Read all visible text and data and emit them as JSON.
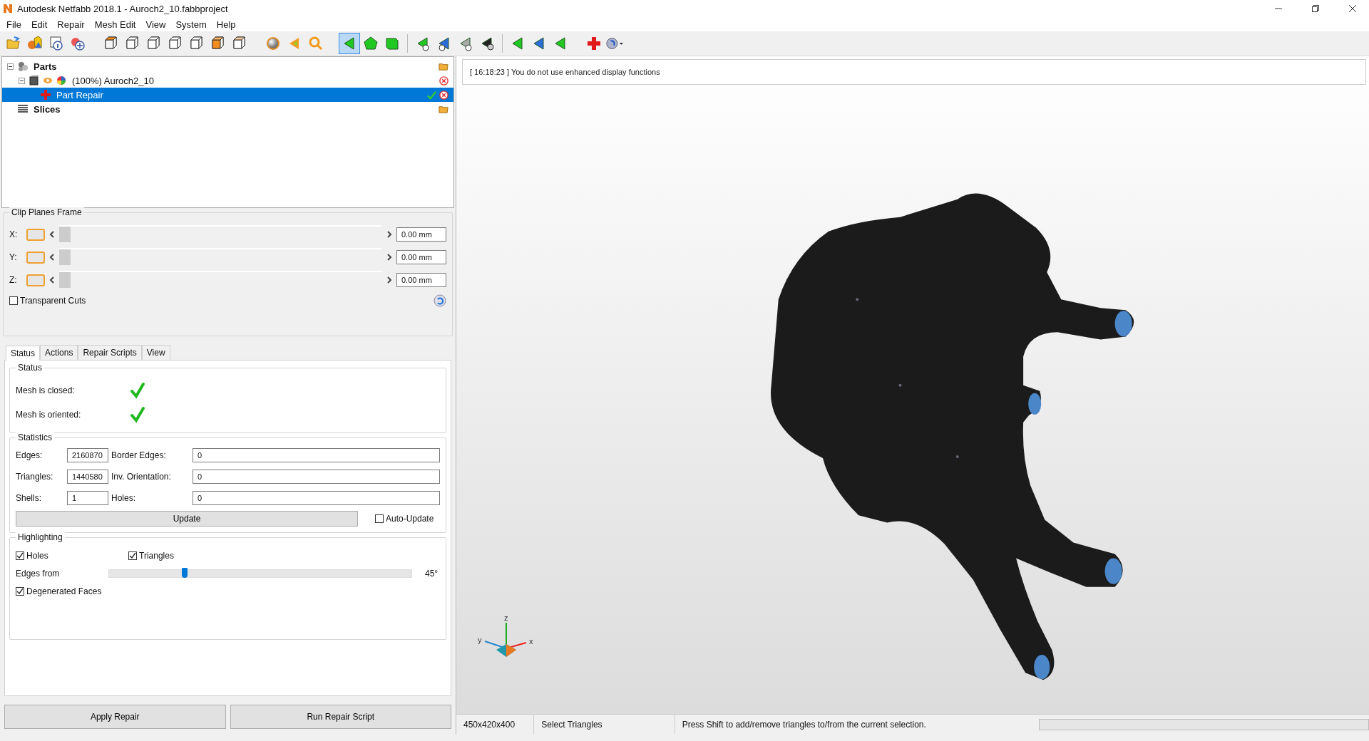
{
  "window": {
    "title": "Autodesk Netfabb 2018.1 - Auroch2_10.fabbproject"
  },
  "menu": [
    "File",
    "Edit",
    "Repair",
    "Mesh Edit",
    "View",
    "System",
    "Help"
  ],
  "toolbar": [
    {
      "kind": "open",
      "selected": false
    },
    {
      "kind": "shapes",
      "selected": false
    },
    {
      "kind": "info",
      "selected": false
    },
    {
      "kind": "add",
      "selected": false
    },
    {
      "kind": "sep"
    },
    {
      "kind": "cube-front",
      "selected": false
    },
    {
      "kind": "cube",
      "selected": false
    },
    {
      "kind": "cube",
      "selected": false
    },
    {
      "kind": "cube",
      "selected": false
    },
    {
      "kind": "cube",
      "selected": false
    },
    {
      "kind": "cube-solid",
      "selected": false
    },
    {
      "kind": "cube-light",
      "selected": false
    },
    {
      "kind": "sep"
    },
    {
      "kind": "sphere",
      "selected": false
    },
    {
      "kind": "pointer",
      "selected": false
    },
    {
      "kind": "zoom",
      "selected": false
    },
    {
      "kind": "sep"
    },
    {
      "kind": "tri-select",
      "selected": true
    },
    {
      "kind": "poly-select",
      "selected": false
    },
    {
      "kind": "box-select",
      "selected": false
    },
    {
      "kind": "line"
    },
    {
      "kind": "tri-add",
      "selected": false
    },
    {
      "kind": "tri-add-blue",
      "selected": false
    },
    {
      "kind": "tri-remove",
      "selected": false
    },
    {
      "kind": "tri-dark",
      "selected": false
    },
    {
      "kind": "line"
    },
    {
      "kind": "tri-green",
      "selected": false
    },
    {
      "kind": "tri-blue",
      "selected": false
    },
    {
      "kind": "tri-green",
      "selected": false
    },
    {
      "kind": "sep"
    },
    {
      "kind": "repair",
      "selected": false
    },
    {
      "kind": "view-menu",
      "selected": false
    }
  ],
  "tree": [
    {
      "label": "Parts",
      "kind": "parts",
      "expanded": true,
      "selected": false,
      "children": [
        {
          "label": "(100%) Auroch2_10",
          "kind": "part",
          "expanded": true,
          "selected": false,
          "children": [
            {
              "label": "Part Repair",
              "kind": "repair",
              "selected": true
            }
          ]
        }
      ]
    },
    {
      "label": "Slices",
      "kind": "slices",
      "selected": false
    }
  ],
  "clip_planes": {
    "title": "Clip Planes Frame",
    "axes": [
      {
        "label": "X:",
        "on": true,
        "level": 0,
        "value": "0.00 mm"
      },
      {
        "label": "Y:",
        "on": true,
        "level": 0,
        "value": "0.00 mm"
      },
      {
        "label": "Z:",
        "on": true,
        "level": 0,
        "value": "0.00 mm"
      }
    ],
    "transparent_cuts": {
      "label": "Transparent Cuts",
      "checked": false
    }
  },
  "tabs": [
    {
      "label": "Status",
      "selected": true
    },
    {
      "label": "Actions",
      "selected": false
    },
    {
      "label": "Repair Scripts",
      "selected": false
    },
    {
      "label": "View",
      "selected": false
    }
  ],
  "status_group": {
    "title": "Status",
    "items": [
      {
        "label": "Mesh is closed:",
        "ok": true
      },
      {
        "label": "Mesh is oriented:",
        "ok": true
      }
    ]
  },
  "statistics": {
    "title": "Statistics",
    "fields": [
      {
        "label": "Edges:",
        "value": "2160870"
      },
      {
        "label": "Border Edges:",
        "value": "0"
      },
      {
        "label": "Triangles:",
        "value": "1440580"
      },
      {
        "label": "Inv. Orientation:",
        "value": "0"
      },
      {
        "label": "Shells:",
        "value": "1"
      },
      {
        "label": "Holes:",
        "value": "0"
      }
    ],
    "update_button": "Update",
    "auto_update": {
      "label": "Auto-Update",
      "checked": false
    }
  },
  "highlighting": {
    "title": "Highlighting",
    "holes": {
      "label": "Holes",
      "checked": true
    },
    "triangles": {
      "label": "Triangles",
      "checked": true
    },
    "edges": {
      "label": "Edges from",
      "level": 0.25,
      "reading": "45°"
    },
    "degenerated": {
      "label": "Degenerated Faces",
      "checked": true
    }
  },
  "buttons": [
    "Apply Repair",
    "Run Repair Script"
  ],
  "viewport": {
    "message": "[ 16:18:23 ] You do not use enhanced display functions",
    "axis_labels": [
      "z",
      "y",
      "x"
    ]
  },
  "status_bar": {
    "dimensions": "450x420x400",
    "mode": "Select Triangles",
    "hint": "Press Shift to add/remove triangles to/from the current selection.",
    "progress": {
      "level": 0
    }
  }
}
